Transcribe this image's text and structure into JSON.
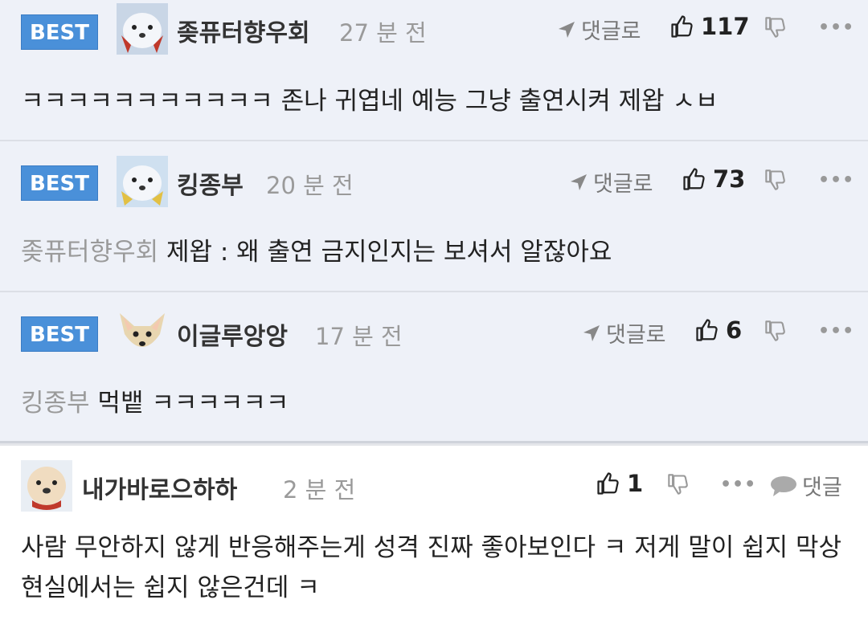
{
  "comments": [
    {
      "best_label": "BEST",
      "nickname": "좆퓨터향우회",
      "time": "27 분 전",
      "reply_label": "댓글로",
      "likes": "117",
      "mention": "",
      "text": "ㅋㅋㅋㅋㅋㅋㅋㅋㅋㅋㅋ 존나 귀엽네 예능 그냥 출연시켜 제왑 ㅅㅂ",
      "avatar_icon": "polar-bear-avatar-icon"
    },
    {
      "best_label": "BEST",
      "nickname": "킹종부",
      "time": "20 분 전",
      "reply_label": "댓글로",
      "likes": "73",
      "mention": "좆퓨터향우회",
      "text": "제왑 : 왜 출연 금지인지는 보셔서 알잖아요",
      "avatar_icon": "polar-bear-avatar-icon"
    },
    {
      "best_label": "BEST",
      "nickname": "이글루앙앙",
      "time": "17 분 전",
      "reply_label": "댓글로",
      "likes": "6",
      "mention": "킹종부",
      "text": "먹뱉 ㅋㅋㅋㅋㅋㅋ",
      "avatar_icon": "chihuahua-avatar-icon"
    },
    {
      "nickname": "내가바로으하하",
      "time": "2 분 전",
      "likes": "1",
      "reply_label": "댓글",
      "text": "사람 무안하지 않게 반응해주는게 성격 진짜 좋아보인다 ㅋ 저게 말이 쉽지 막상 현실에서는 쉽지 않은건데 ㅋ",
      "avatar_icon": "puppy-avatar-icon"
    }
  ],
  "icons": {
    "thumbs_up": "thumbs-up-icon",
    "thumbs_down": "thumbs-down-icon",
    "more": "more-dots-icon",
    "reply_arrow": "reply-arrow-icon",
    "speech": "speech-bubble-icon"
  },
  "colors": {
    "best_badge": "#4a90d9",
    "best_bg": "#eef1f8",
    "muted": "#9a9a9a"
  }
}
